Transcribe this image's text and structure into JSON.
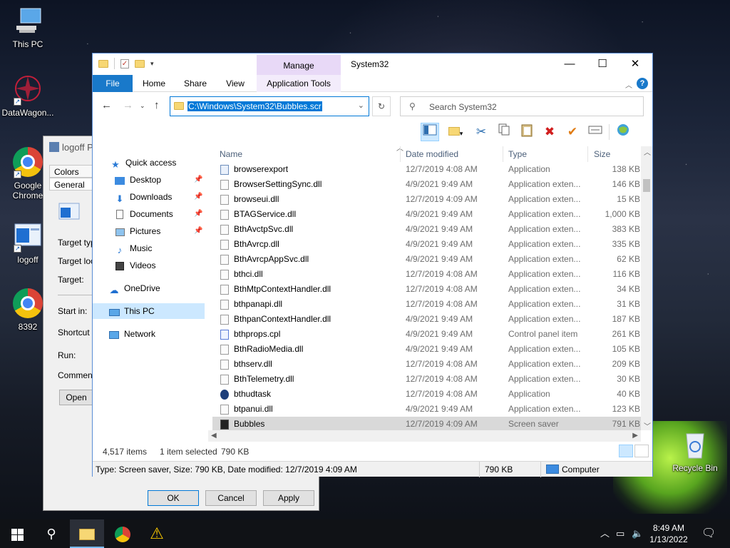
{
  "desktop": {
    "icons": [
      {
        "label": "This PC"
      },
      {
        "label": "DataWagon..."
      },
      {
        "label": "Google Chrome"
      },
      {
        "label": "logoff"
      },
      {
        "label": "8392"
      },
      {
        "label": "Recycle Bin"
      }
    ]
  },
  "properties": {
    "title": "logoff P",
    "tabs": [
      "Colors",
      "General"
    ],
    "fields": [
      "Target typ",
      "Target loc",
      "Target:",
      "Start in:",
      "Shortcut k",
      "Run:",
      "Comment:"
    ],
    "open_btn": "Open",
    "ok": "OK",
    "cancel": "Cancel",
    "apply": "Apply"
  },
  "explorer": {
    "title": "System32",
    "manage": "Manage",
    "tabs": {
      "file": "File",
      "home": "Home",
      "share": "Share",
      "view": "View",
      "apptools": "Application Tools"
    },
    "address": "C:\\Windows\\System32\\Bubbles.scr",
    "search_placeholder": "Search System32",
    "nav": {
      "quick_access": "Quick access",
      "desktop": "Desktop",
      "downloads": "Downloads",
      "documents": "Documents",
      "pictures": "Pictures",
      "music": "Music",
      "videos": "Videos",
      "onedrive": "OneDrive",
      "thispc": "This PC",
      "network": "Network"
    },
    "columns": {
      "name": "Name",
      "date": "Date modified",
      "type": "Type",
      "size": "Size"
    },
    "files": [
      {
        "name": "browserexport",
        "date": "12/7/2019 4:08 AM",
        "type": "Application",
        "size": "138 KB",
        "icon": "app"
      },
      {
        "name": "BrowserSettingSync.dll",
        "date": "4/9/2021 9:49 AM",
        "type": "Application exten...",
        "size": "146 KB",
        "icon": "dll"
      },
      {
        "name": "browseui.dll",
        "date": "12/7/2019 4:09 AM",
        "type": "Application exten...",
        "size": "15 KB",
        "icon": "dll"
      },
      {
        "name": "BTAGService.dll",
        "date": "4/9/2021 9:49 AM",
        "type": "Application exten...",
        "size": "1,000 KB",
        "icon": "dll"
      },
      {
        "name": "BthAvctpSvc.dll",
        "date": "4/9/2021 9:49 AM",
        "type": "Application exten...",
        "size": "383 KB",
        "icon": "dll"
      },
      {
        "name": "BthAvrcp.dll",
        "date": "4/9/2021 9:49 AM",
        "type": "Application exten...",
        "size": "335 KB",
        "icon": "dll"
      },
      {
        "name": "BthAvrcpAppSvc.dll",
        "date": "4/9/2021 9:49 AM",
        "type": "Application exten...",
        "size": "62 KB",
        "icon": "dll"
      },
      {
        "name": "bthci.dll",
        "date": "12/7/2019 4:08 AM",
        "type": "Application exten...",
        "size": "116 KB",
        "icon": "dll"
      },
      {
        "name": "BthMtpContextHandler.dll",
        "date": "12/7/2019 4:08 AM",
        "type": "Application exten...",
        "size": "34 KB",
        "icon": "dll"
      },
      {
        "name": "bthpanapi.dll",
        "date": "12/7/2019 4:08 AM",
        "type": "Application exten...",
        "size": "31 KB",
        "icon": "dll"
      },
      {
        "name": "BthpanContextHandler.dll",
        "date": "4/9/2021 9:49 AM",
        "type": "Application exten...",
        "size": "187 KB",
        "icon": "dll"
      },
      {
        "name": "bthprops.cpl",
        "date": "4/9/2021 9:49 AM",
        "type": "Control panel item",
        "size": "261 KB",
        "icon": "cpl"
      },
      {
        "name": "BthRadioMedia.dll",
        "date": "4/9/2021 9:49 AM",
        "type": "Application exten...",
        "size": "105 KB",
        "icon": "dll"
      },
      {
        "name": "bthserv.dll",
        "date": "12/7/2019 4:08 AM",
        "type": "Application exten...",
        "size": "209 KB",
        "icon": "dll"
      },
      {
        "name": "BthTelemetry.dll",
        "date": "12/7/2019 4:08 AM",
        "type": "Application exten...",
        "size": "30 KB",
        "icon": "dll"
      },
      {
        "name": "bthudtask",
        "date": "12/7/2019 4:08 AM",
        "type": "Application",
        "size": "40 KB",
        "icon": "bt"
      },
      {
        "name": "btpanui.dll",
        "date": "4/9/2021 9:49 AM",
        "type": "Application exten...",
        "size": "123 KB",
        "icon": "dll"
      },
      {
        "name": "Bubbles",
        "date": "12/7/2019 4:09 AM",
        "type": "Screen saver",
        "size": "791 KB",
        "icon": "scr"
      }
    ],
    "status": {
      "items": "4,517 items",
      "selected": "1 item selected",
      "selsize": "790 KB"
    },
    "statusbar": {
      "desc": "Type: Screen saver, Size: 790 KB, Date modified: 12/7/2019 4:09 AM",
      "size": "790 KB",
      "location": "Computer"
    }
  },
  "taskbar": {
    "time": "8:49 AM",
    "date": "1/13/2022"
  }
}
